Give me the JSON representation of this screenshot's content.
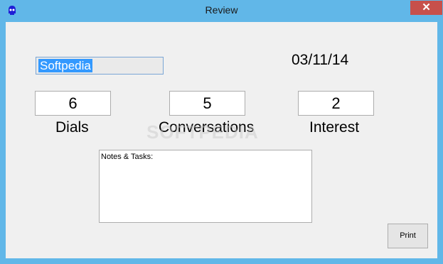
{
  "window": {
    "title": "Review",
    "close_symbol": "✕",
    "app_icon": "app-icon"
  },
  "form": {
    "name_value": "Softpedia",
    "date": "03/11/14"
  },
  "stats": [
    {
      "label": "Dials",
      "value": "6"
    },
    {
      "label": "Conversations",
      "value": "5"
    },
    {
      "label": "Interest",
      "value": "2"
    }
  ],
  "notes": {
    "text": "Notes & Tasks:"
  },
  "buttons": {
    "print_label": "Print"
  },
  "watermark": {
    "text": "SOFTPEDIA"
  }
}
